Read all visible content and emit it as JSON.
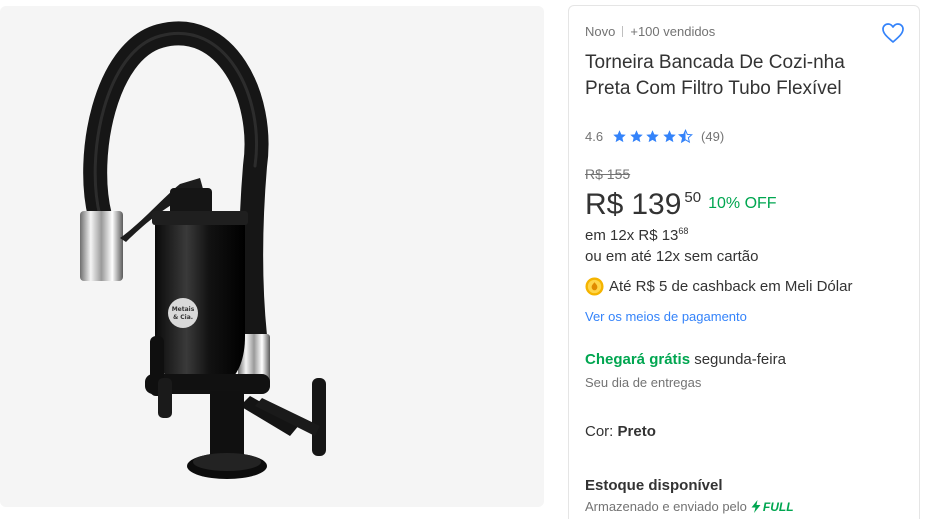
{
  "product": {
    "condition": "Novo",
    "sold": "+100 vendidos",
    "title": "Torneira Bancada De Cozi-nha Preta Com Filtro Tubo Flexível",
    "rating_value": "4.6",
    "rating_stars": 4.5,
    "review_count": "(49)",
    "favorite_icon": "heart-outline-icon",
    "image_alt": "Torneira preta com filtro e tubo flexível"
  },
  "pricing": {
    "old_price": "R$ 155",
    "currency": "R$",
    "price_int": "139",
    "price_cents": "50",
    "discount": "10% OFF",
    "installments_prefix": "em 12x R$ 13",
    "installments_cents": "68",
    "no_card": "ou em até 12x sem cartão",
    "cashback": "Até R$ 5 de cashback em Meli Dólar",
    "payment_link": "Ver os meios de pagamento"
  },
  "shipping": {
    "arrives_label": "Chegará grátis",
    "arrives_day": " segunda-feira",
    "sub": "Seu dia de entregas"
  },
  "variant": {
    "color_label": "Cor: ",
    "color_value": "Preto"
  },
  "stock": {
    "label": "Estoque disponível",
    "sub": "Armazenado e enviado pelo",
    "full_badge": "FULL"
  },
  "image_text": {
    "logo_line1": "Metais",
    "logo_line2": "& Cia."
  },
  "colors": {
    "accent_blue": "#3483fa",
    "green": "#00a650",
    "text": "#333333",
    "muted": "#737373"
  }
}
